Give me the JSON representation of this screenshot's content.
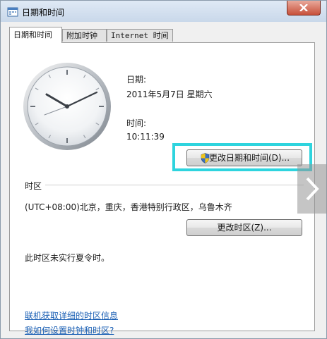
{
  "window": {
    "title": "日期和时间",
    "close_icon": "close-icon"
  },
  "tabs": [
    {
      "label": "日期和时间",
      "active": true
    },
    {
      "label": "附加时钟",
      "active": false
    },
    {
      "label": "Internet 时间",
      "active": false
    }
  ],
  "datetime": {
    "date_label": "日期:",
    "date_value": "2011年5月7日 星期六",
    "time_label": "时间:",
    "time_value": "10:11:39",
    "change_button": "更改日期和时间(D)..."
  },
  "timezone": {
    "section_label": "时区",
    "value": "(UTC+08:00)北京，重庆，香港特别行政区，乌鲁木齐",
    "change_button": "更改时区(Z)...",
    "dst_note": "此时区未实行夏令时。"
  },
  "links": {
    "online_info": "联机获取详细的时区信息",
    "how_to": "我如何设置时钟和时区?"
  },
  "colors": {
    "highlight": "#2ed4de",
    "link": "#1a5fb4"
  }
}
